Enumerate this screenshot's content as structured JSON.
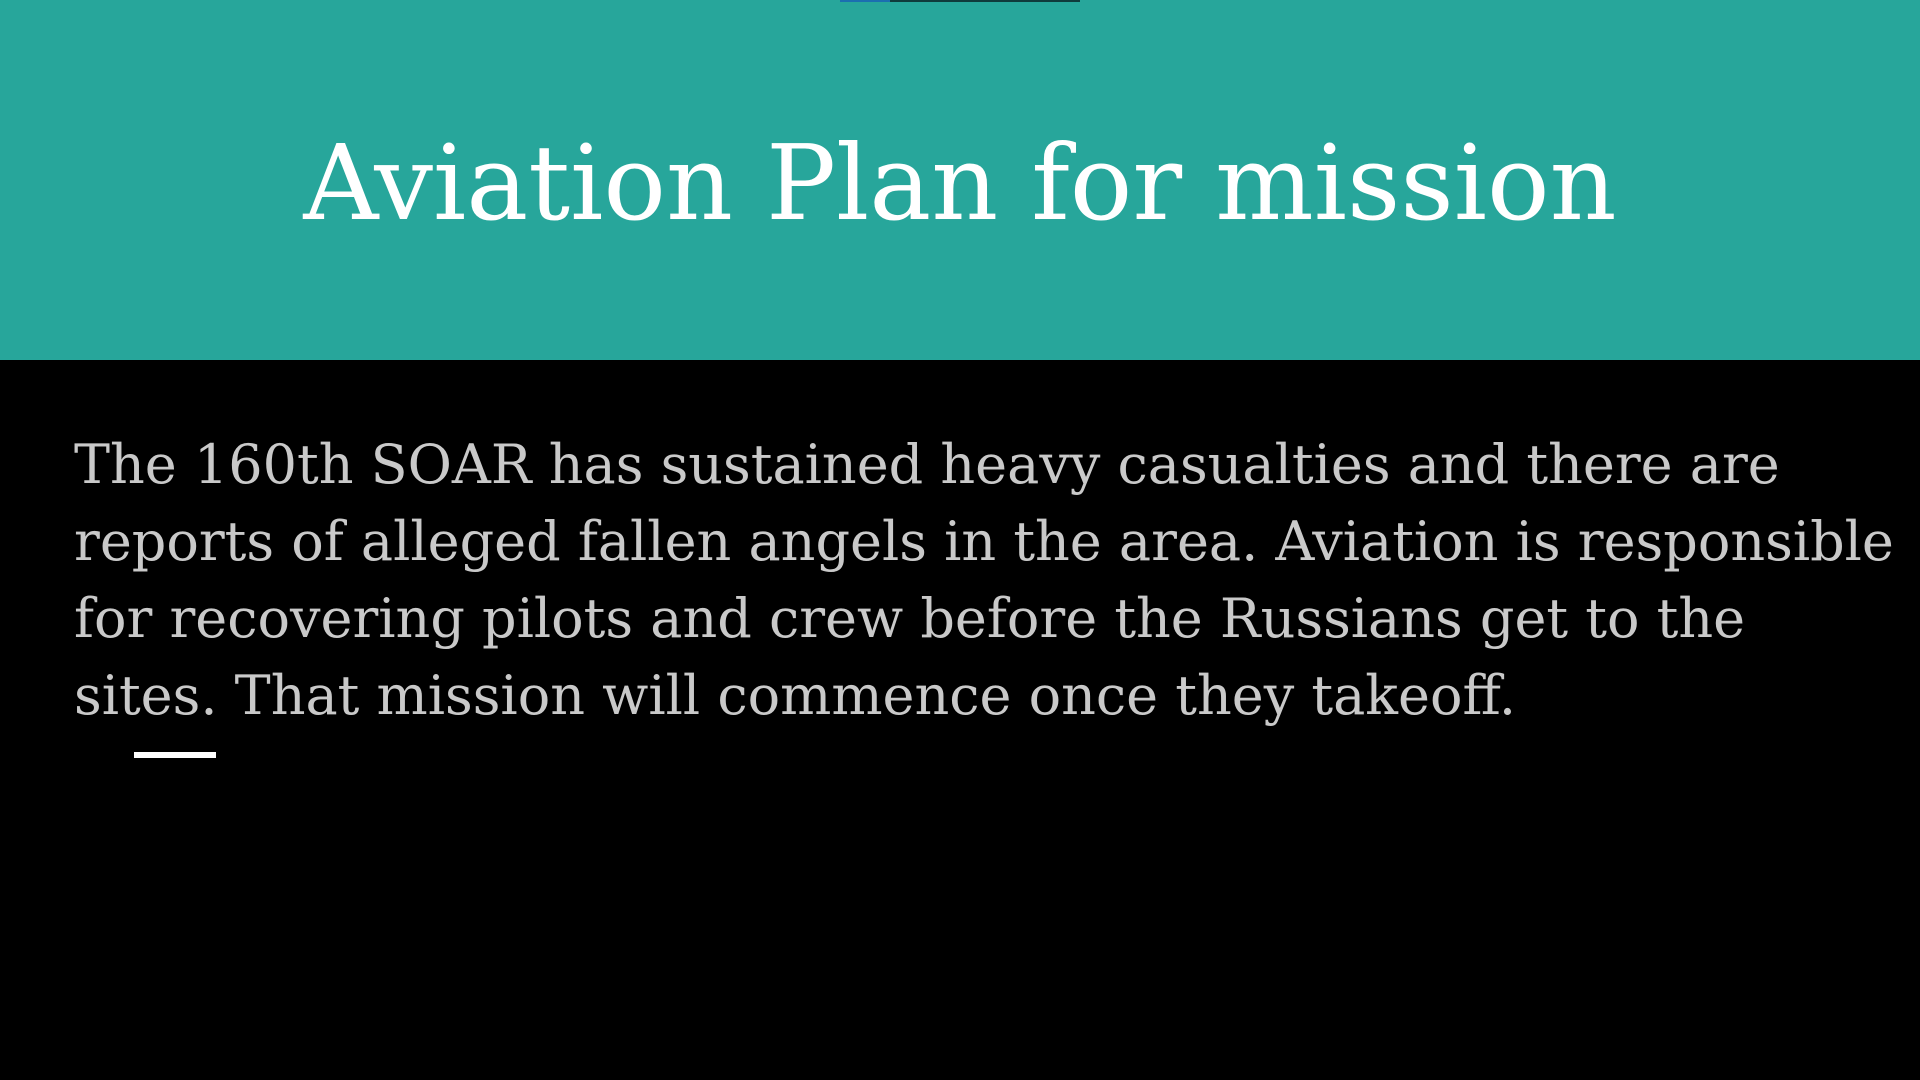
{
  "slide": {
    "title": "Aviation Plan for mission",
    "body": "The 160th SOAR has sustained heavy casualties and there are reports of alleged fallen angels in the area. Aviation is responsible for recovering pilots and crew before the Russians get to the sites. That mission will commence once they takeoff."
  },
  "colors": {
    "header_background": "#27a69b",
    "slide_background": "#000000",
    "title_text": "#ffffff",
    "body_text": "#c9c9c9",
    "accent_bar": "#ffffff"
  }
}
